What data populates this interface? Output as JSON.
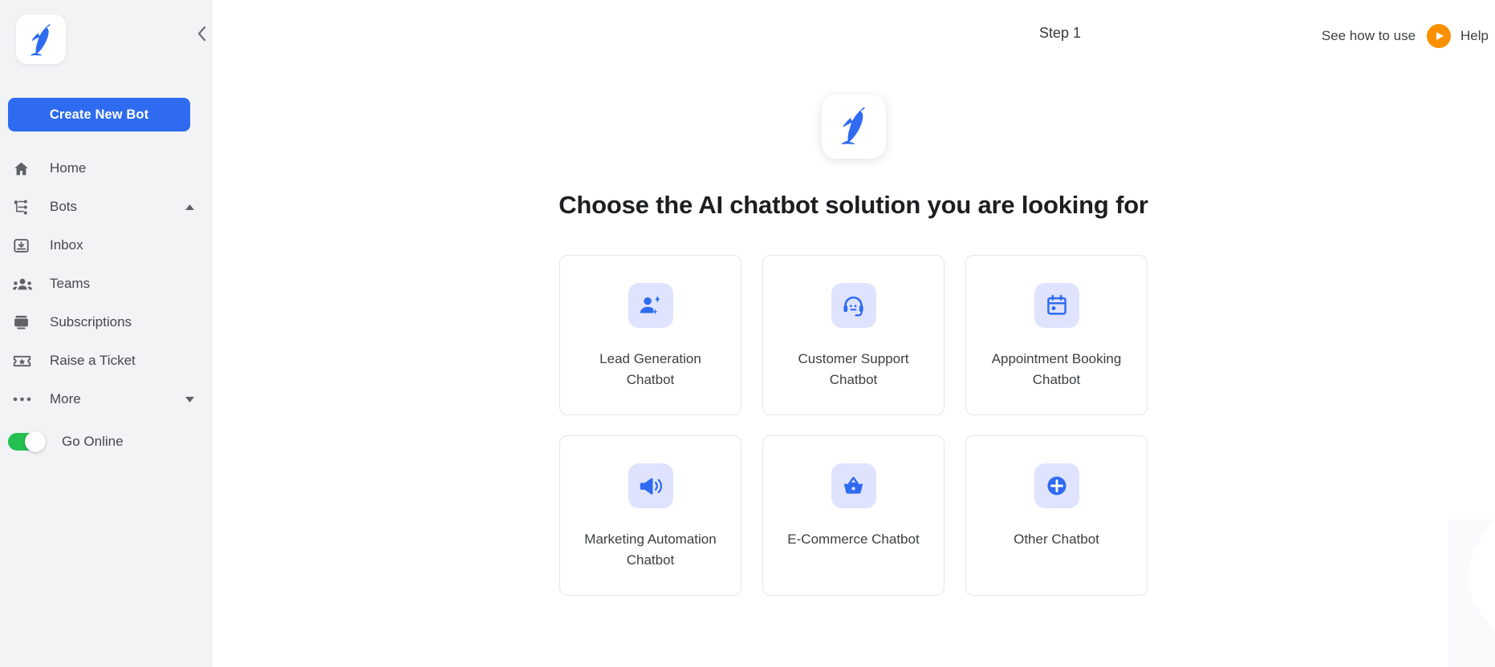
{
  "brand": {
    "logo_icon": "penguin-logo-icon",
    "logo_color": "#2f6bf0",
    "accent_blue": "#2f6bf0",
    "accent_orange": "#fa9000",
    "toggle_green": "#25c04f",
    "icon_tile_bg": "#dfe3fe"
  },
  "sidebar": {
    "collapse_icon": "chevron-left-icon",
    "create_button": "Create New Bot",
    "items": [
      {
        "label": "Home",
        "icon": "home-icon",
        "caret": ""
      },
      {
        "label": "Bots",
        "icon": "account-tree-icon",
        "caret": "caret-up-icon"
      },
      {
        "label": "Inbox",
        "icon": "inbox-icon",
        "caret": ""
      },
      {
        "label": "Teams",
        "icon": "people-icon",
        "caret": ""
      },
      {
        "label": "Subscriptions",
        "icon": "subscriptions-icon",
        "caret": ""
      },
      {
        "label": "Raise a Ticket",
        "icon": "ticket-icon",
        "caret": ""
      },
      {
        "label": "More",
        "icon": "more-horizontal-icon",
        "caret": "caret-down-icon"
      }
    ],
    "go_online": {
      "label": "Go Online",
      "state": "on"
    }
  },
  "header": {
    "step": "Step 1",
    "see_how_to_use": "See how to use",
    "play_icon": "play-icon",
    "help": "Help"
  },
  "main": {
    "hero_logo_icon": "penguin-logo-icon",
    "title": "Choose the AI chatbot solution you are looking for",
    "cards": [
      {
        "label": "Lead Generation Chatbot",
        "icon": "person-add-sparkle-icon"
      },
      {
        "label": "Customer Support Chatbot",
        "icon": "headset-support-icon"
      },
      {
        "label": "Appointment Booking Chatbot",
        "icon": "calendar-event-icon"
      },
      {
        "label": "Marketing Automation Chatbot",
        "icon": "megaphone-icon"
      },
      {
        "label": "E-Commerce Chatbot",
        "icon": "shopping-basket-icon"
      },
      {
        "label": "Other Chatbot",
        "icon": "plus-circle-icon"
      }
    ]
  }
}
